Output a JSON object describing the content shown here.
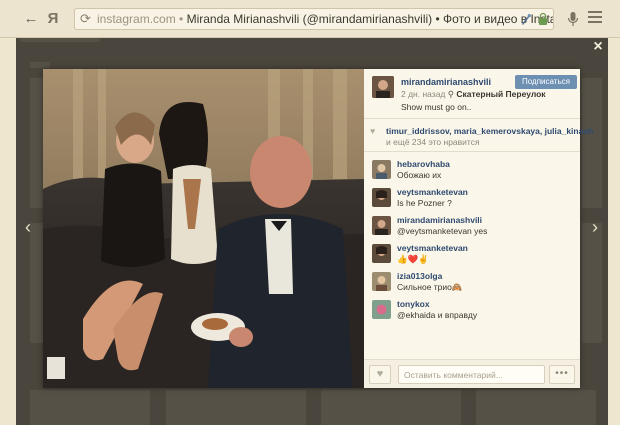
{
  "browser": {
    "back_icon": "←",
    "yandex_logo": "Я",
    "reload_icon": "⟳",
    "url_domain": "instagram.com",
    "url_separator": " • ",
    "tab_title": "Miranda Mirianashvili (@mirandamirianashvili) • Фото и видео в Instagram"
  },
  "modal": {
    "close_icon": "×",
    "prev_icon": "‹",
    "next_icon": "›",
    "post": {
      "username": "mirandamirianashvili",
      "follow_label": "Подписаться",
      "time_ago": "2 дн. назад",
      "location_pin": "⚲",
      "location": "Скатерный Переулок",
      "caption": "Show must go on.."
    },
    "likes": {
      "names": "timur_iddrissov, maria_kemerovskaya, julia_kinash",
      "more_text": "и ещё 234 это нравится"
    },
    "comments": [
      {
        "user": "hebarovhaba",
        "text": "Обожаю их"
      },
      {
        "user": "veytsmanketevan",
        "text": "Is he Pozner ?"
      },
      {
        "user": "mirandamirianashvili",
        "text": "@veytsmanketevan yes"
      },
      {
        "user": "veytsmanketevan",
        "text": "👍❤️✌️"
      },
      {
        "user": "izia013olga",
        "text": "Сильное трио🙈"
      },
      {
        "user": "tonykox",
        "text": "@ekhaida и вправду"
      }
    ],
    "footer": {
      "like_icon": "♥",
      "comment_placeholder": "Оставить комментарий...",
      "more_label": "•••"
    }
  },
  "colors": {
    "link_blue": "#2e4a6f",
    "follow_button": "#6d8fb2",
    "overlay": "#4a463d"
  }
}
